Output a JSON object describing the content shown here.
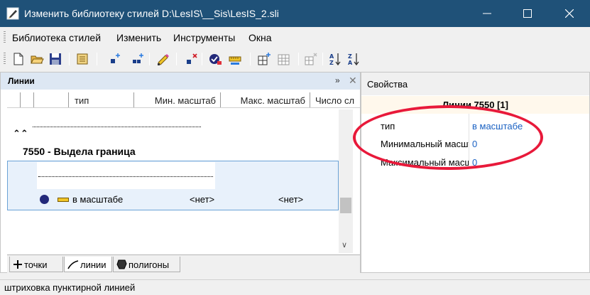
{
  "window": {
    "title": "Изменить библиотеку стилей D:\\LesIS\\__Sis\\LesIS_2.sli"
  },
  "menu": [
    "Библиотека стилей",
    "Изменить",
    "Инструменты",
    "Окна"
  ],
  "toolbar": {
    "icons": [
      "new-file-icon",
      "open-folder-icon",
      "save-icon",
      "library-icon",
      "add-point-icon",
      "add-group-icon",
      "edit-pencil-icon",
      "delete-icon",
      "properties-check-icon",
      "ruler-icon",
      "table-add-icon",
      "table-grid-icon",
      "table-delete-icon",
      "sort-az-icon",
      "sort-za-icon"
    ]
  },
  "lines_pane": {
    "title": "Линии",
    "columns": [
      "",
      "",
      "",
      "тип",
      "Мин. масштаб",
      "Макс. масштаб",
      "Число сл"
    ],
    "group_title": "7550 - Выдела граница",
    "row": {
      "type": "в масштабе",
      "min_scale": "<нет>",
      "max_scale": "<нет>"
    },
    "tabs": [
      {
        "label": "точки",
        "icon": "plus-icon"
      },
      {
        "label": "линии",
        "icon": "line-icon"
      },
      {
        "label": "полигоны",
        "icon": "polygon-icon"
      }
    ]
  },
  "properties": {
    "title": "Свойства",
    "header": "Линии 7550 [1]",
    "rows": [
      {
        "name": "тип",
        "value": "в масштабе"
      },
      {
        "name": "Минимальный масштаб",
        "value": "0"
      },
      {
        "name": "Максимальный масштаб",
        "value": "0"
      }
    ]
  },
  "status": {
    "text": "штриховка пунктирной линией"
  },
  "colors": {
    "titlebar": "#1f5178",
    "accent_link": "#1b62c3",
    "selection": "#e8f1fb",
    "annotation_ellipse": "#e8193a"
  }
}
